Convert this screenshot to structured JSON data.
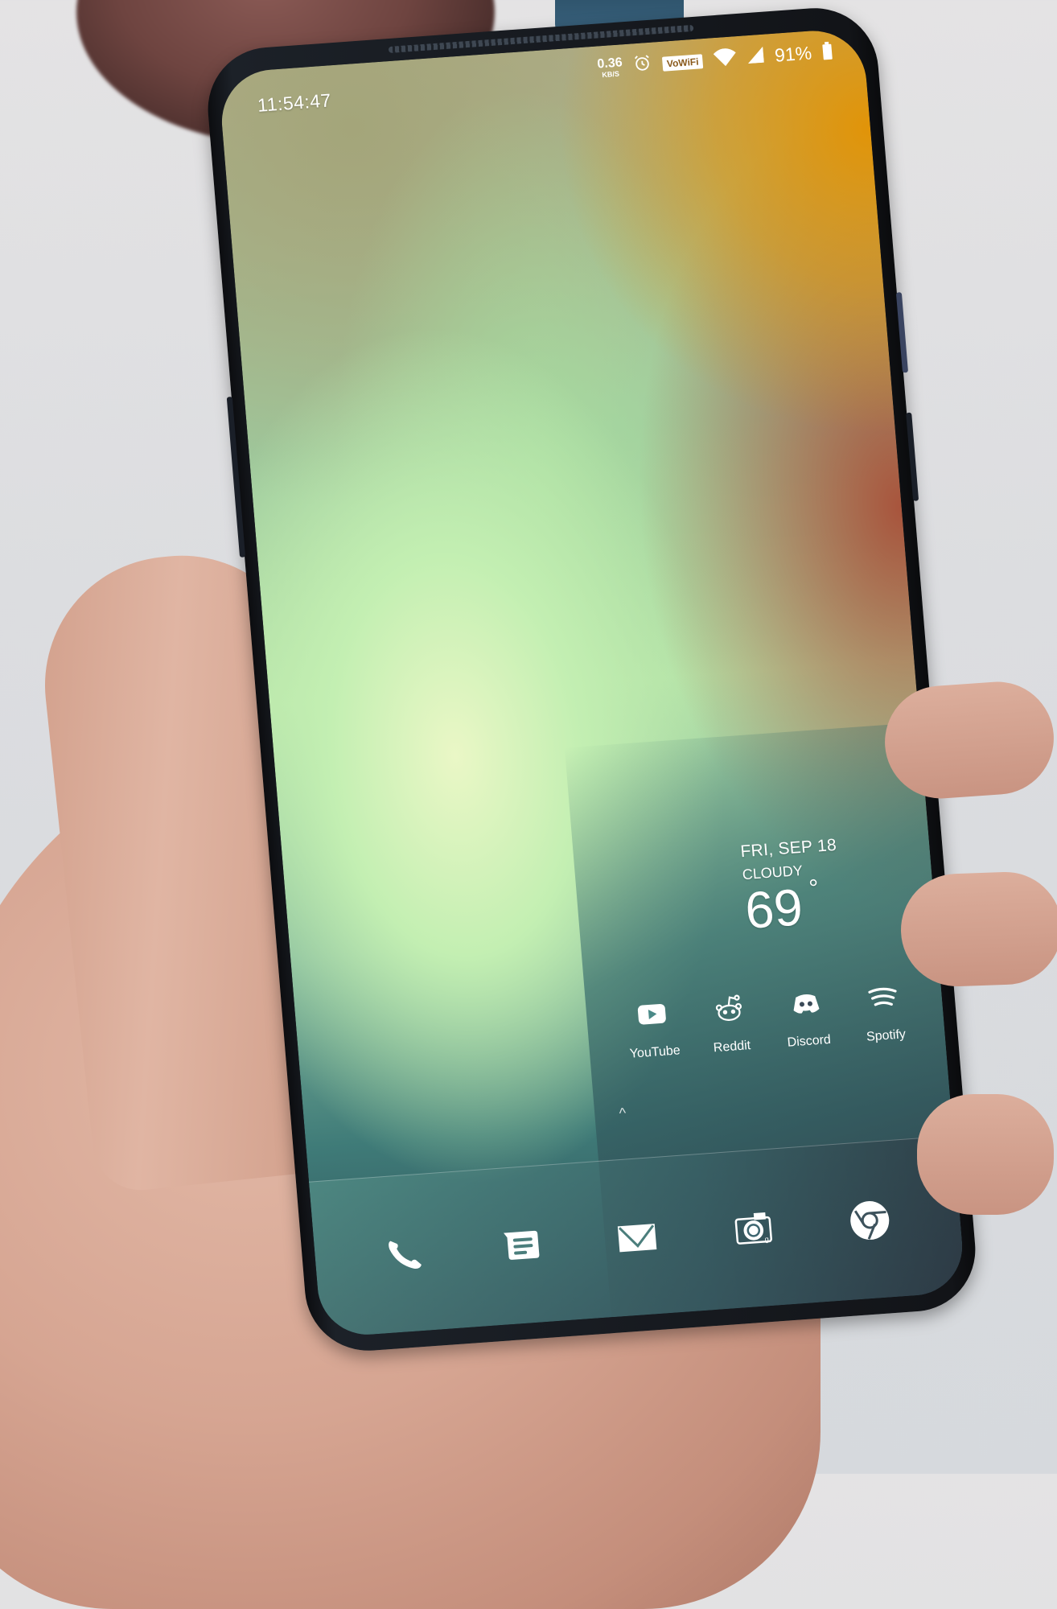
{
  "status_bar": {
    "time": "11:54:47",
    "net_speed_value": "0.36",
    "net_speed_unit": "KB/S",
    "alarm_icon": "alarm-clock-icon",
    "vowifi_label": "VoWiFi",
    "wifi_icon": "wifi-icon",
    "signal_icon": "cell-signal-icon",
    "battery_percent": "91%",
    "battery_level": 0.91
  },
  "weather_widget": {
    "date": "FRI, SEP 18",
    "condition": "CLOUDY",
    "temperature": "69",
    "degree_symbol": "°"
  },
  "home_apps": [
    {
      "label": "YouTube",
      "icon": "youtube-icon"
    },
    {
      "label": "Reddit",
      "icon": "reddit-icon"
    },
    {
      "label": "Discord",
      "icon": "discord-icon"
    },
    {
      "label": "Spotify",
      "icon": "spotify-icon"
    }
  ],
  "app_drawer_indicator": "^",
  "dock": [
    {
      "name": "Phone",
      "icon": "phone-icon"
    },
    {
      "name": "Messages",
      "icon": "messages-icon"
    },
    {
      "name": "Email",
      "icon": "email-icon"
    },
    {
      "name": "Camera",
      "icon": "camera-icon"
    },
    {
      "name": "Chrome",
      "icon": "chrome-icon"
    }
  ],
  "colors": {
    "wallpaper_orange": "#e19408",
    "wallpaper_green": "#b6e3a8",
    "wallpaper_teal": "#3f7b78",
    "icon_color": "#ffffff"
  }
}
